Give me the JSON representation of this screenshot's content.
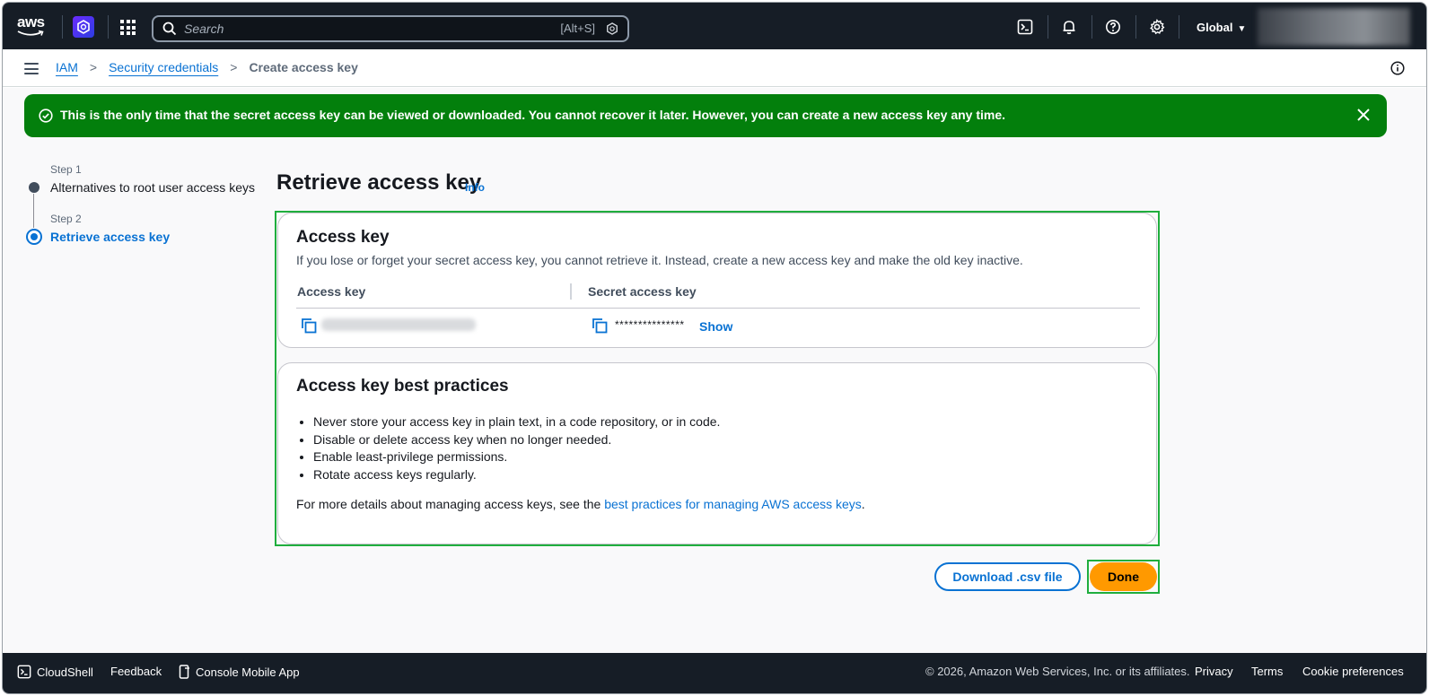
{
  "topnav": {
    "logo_text": "aws",
    "search_placeholder": "Search",
    "search_shortcut": "[Alt+S]",
    "region": "Global",
    "icons": [
      "cloudshell-icon",
      "bell-icon",
      "help-icon",
      "gear-icon"
    ]
  },
  "breadcrumb": {
    "items": [
      "IAM",
      "Security credentials",
      "Create access key"
    ]
  },
  "flash": {
    "message": "This is the only time that the secret access key can be viewed or downloaded. You cannot recover it later. However, you can create a new access key any time."
  },
  "steps": [
    {
      "label": "Step 1",
      "title": "Alternatives to root user access keys"
    },
    {
      "label": "Step 2",
      "title": "Retrieve access key"
    }
  ],
  "page": {
    "title": "Retrieve access key",
    "info": "Info"
  },
  "access_key_card": {
    "title": "Access key",
    "description": "If you lose or forget your secret access key, you cannot retrieve it. Instead, create a new access key and make the old key inactive.",
    "columns": [
      "Access key",
      "Secret access key"
    ],
    "secret_masked": "***************",
    "show_label": "Show"
  },
  "best_practices": {
    "title": "Access key best practices",
    "items": [
      "Never store your access key in plain text, in a code repository, or in code.",
      "Disable or delete access key when no longer needed.",
      "Enable least-privilege permissions.",
      "Rotate access keys regularly."
    ],
    "more_prefix": "For more details about managing access keys, see the ",
    "more_link": "best practices for managing AWS access keys",
    "more_suffix": "."
  },
  "actions": {
    "download": "Download .csv file",
    "done": "Done"
  },
  "footer": {
    "cloudshell": "CloudShell",
    "feedback": "Feedback",
    "mobile_app": "Console Mobile App",
    "copyright": "© 2026, Amazon Web Services, Inc. or its affiliates.",
    "privacy": "Privacy",
    "terms": "Terms",
    "cookies": "Cookie preferences"
  },
  "colors": {
    "nav_bg": "#161d26",
    "link": "#0972d3",
    "success": "#037f0c",
    "primary_button": "#ff9900",
    "highlight": "#1fae3d"
  }
}
